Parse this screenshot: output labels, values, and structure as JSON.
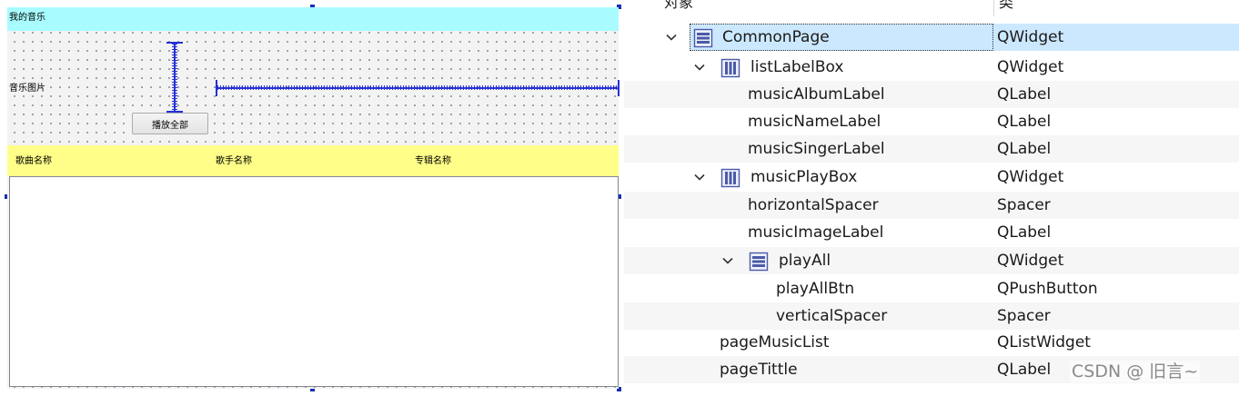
{
  "designer": {
    "page_title": "我的音乐",
    "music_image_label": "音乐图片",
    "play_all_button": "播放全部",
    "list_labels": [
      "歌曲名称",
      "歌手名称",
      "专辑名称"
    ]
  },
  "inspector": {
    "headers": {
      "object": "对象",
      "class": "类"
    },
    "rows": [
      {
        "name": "CommonPage",
        "class": "QWidget",
        "icon": "vertical-layout-icon",
        "expanded": true
      },
      {
        "name": "listLabelBox",
        "class": "QWidget",
        "icon": "horizontal-layout-icon",
        "expanded": true
      },
      {
        "name": "musicAlbumLabel",
        "class": "QLabel"
      },
      {
        "name": "musicNameLabel",
        "class": "QLabel"
      },
      {
        "name": "musicSingerLabel",
        "class": "QLabel"
      },
      {
        "name": "musicPlayBox",
        "class": "QWidget",
        "icon": "horizontal-layout-icon",
        "expanded": true
      },
      {
        "name": "horizontalSpacer",
        "class": "Spacer"
      },
      {
        "name": "musicImageLabel",
        "class": "QLabel"
      },
      {
        "name": "playAll",
        "class": "QWidget",
        "icon": "vertical-layout-icon",
        "expanded": true
      },
      {
        "name": "playAllBtn",
        "class": "QPushButton"
      },
      {
        "name": "verticalSpacer",
        "class": "Spacer"
      },
      {
        "name": "pageMusicList",
        "class": "QListWidget"
      },
      {
        "name": "pageTittle",
        "class": "QLabel"
      }
    ]
  },
  "watermark": "CSDN @ 旧言~",
  "colors": {
    "title_bar": "#a8fcff",
    "list_label_box": "#fefe88",
    "spacer": "#2530d6",
    "selection": "#cce8ff"
  }
}
